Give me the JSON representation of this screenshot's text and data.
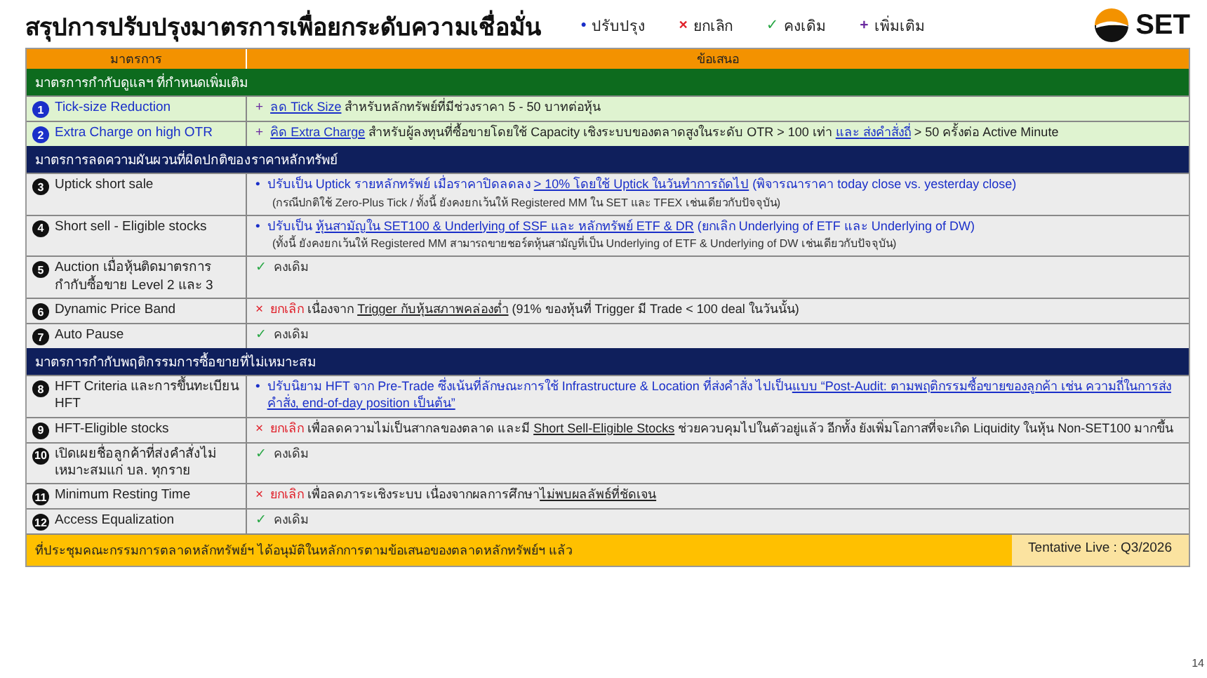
{
  "title": "สรุปการปรับปรุงมาตรการเพื่อยกระดับความเชื่อมั่น",
  "legend": [
    {
      "kind": "improve",
      "symbol": "•",
      "label": "ปรับปรุง"
    },
    {
      "kind": "cancel",
      "symbol": "×",
      "label": "ยกเลิก"
    },
    {
      "kind": "keep",
      "symbol": "✓",
      "label": "คงเดิม"
    },
    {
      "kind": "add",
      "symbol": "+",
      "label": "เพิ่มเติม"
    }
  ],
  "logo": {
    "text": "SET"
  },
  "table": {
    "columns": [
      "มาตรการ",
      "ข้อเสนอ"
    ],
    "sections": [
      {
        "kind": "added",
        "title": "มาตรการกำกับดูแลฯ ที่กำหนดเพิ่มเติม",
        "rows": [
          {
            "number": "1",
            "measure": "Tick-size Reduction",
            "proposal": {
              "kind": "add",
              "symbol": "+",
              "lines": [
                [
                  {
                    "text": "ลด Tick Size",
                    "emphasis": true
                  },
                  {
                    "text": " สำหรับหลักทรัพย์ที่มีช่วงราคา 5 - 50 บาทต่อหุ้น",
                    "emphasis": false
                  }
                ]
              ]
            }
          },
          {
            "number": "2",
            "measure": "Extra Charge on high OTR",
            "proposal": {
              "kind": "add",
              "symbol": "+",
              "lines": [
                [
                  {
                    "text": "คิด Extra Charge",
                    "emphasis": true
                  },
                  {
                    "text": " สำหรับผู้ลงทุนที่ซื้อขายโดยใช้ Capacity เชิงระบบของตลาดสูงในระดับ OTR > 100 เท่า ",
                    "emphasis": false
                  },
                  {
                    "text": "และ",
                    "emphasis": true
                  },
                  {
                    "text": " ส่งคำสั่งถี่",
                    "emphasis": true
                  },
                  {
                    "text": " > 50 ครั้งต่อ Active Minute",
                    "emphasis": false
                  }
                ]
              ]
            }
          }
        ]
      },
      {
        "kind": "standard",
        "title": "มาตรการลดความผันผวนที่ผิดปกติของราคาหลักทรัพย์",
        "rows": [
          {
            "number": "3",
            "measure": "Uptick short sale",
            "proposal": {
              "kind": "improve",
              "symbol": "•",
              "lines": [
                [
                  {
                    "text": "ปรับเป็น Uptick รายหลักทรัพย์ เมื่อราคาปิดลดลง ",
                    "emphasis": false
                  },
                  {
                    "text": "> 10% โดยใช้ Uptick ในวันทำการถัดไป",
                    "emphasis": true
                  },
                  {
                    "text": " (พิจารณาราคา today close vs. yesterday close)",
                    "emphasis": false
                  }
                ]
              ],
              "note": "(กรณีปกติใช้ Zero-Plus Tick / ทั้งนี้ ยังคงยกเว้นให้ Registered MM ใน SET และ TFEX เช่นเดียวกับปัจจุบัน)"
            }
          },
          {
            "number": "4",
            "measure": "Short sell - Eligible stocks",
            "proposal": {
              "kind": "improve",
              "symbol": "•",
              "lines": [
                [
                  {
                    "text": "ปรับเป็น ",
                    "emphasis": false
                  },
                  {
                    "text": "หุ้นสามัญใน SET100 & Underlying of SSF และ หลักทรัพย์ ETF & DR",
                    "emphasis": true
                  },
                  {
                    "text": "  (ยกเลิก Underlying of ETF และ Underlying of DW)",
                    "emphasis": false
                  }
                ]
              ],
              "note": "(ทั้งนี้ ยังคงยกเว้นให้ Registered MM สามารถขายชอร์ตหุ้นสามัญที่เป็น Underlying of ETF & Underlying of DW เช่นเดียวกับปัจจุบัน)"
            }
          },
          {
            "number": "5",
            "measure": "Auction เมื่อหุ้นติดมาตรการกำกับซื้อขาย Level 2 และ 3",
            "proposal": {
              "kind": "keep",
              "symbol": "✓",
              "label": "คงเดิม"
            }
          },
          {
            "number": "6",
            "measure": "Dynamic Price Band",
            "proposal": {
              "kind": "cancel",
              "symbol": "×",
              "label": "ยกเลิก",
              "lines": [
                [
                  {
                    "text": " เนื่องจาก ",
                    "emphasis": false
                  },
                  {
                    "text": "Trigger กับหุ้นสภาพคล่องต่ำ",
                    "emphasis": true
                  },
                  {
                    "text": " (91% ของหุ้นที่ Trigger มี Trade < 100 deal ในวันนั้น)",
                    "emphasis": false
                  }
                ]
              ]
            }
          },
          {
            "number": "7",
            "measure": "Auto Pause",
            "proposal": {
              "kind": "keep",
              "symbol": "✓",
              "label": "คงเดิม"
            }
          }
        ]
      },
      {
        "kind": "standard",
        "title": "มาตรการกำกับพฤติกรรมการซื้อขายที่ไม่เหมาะสม",
        "rows": [
          {
            "number": "8",
            "measure": "HFT Criteria และการขึ้นทะเบียน HFT",
            "proposal": {
              "kind": "improve",
              "symbol": "•",
              "lines": [
                [
                  {
                    "text": "ปรับนิยาม HFT",
                    "emphasis": false
                  },
                  {
                    "text": " จาก Pre-Trade ซึ่งเน้นที่ลักษณะการใช้ Infrastructure & Location ที่ส่งคำสั่ง ไปเป็น",
                    "emphasis": false
                  },
                  {
                    "text": "แบบ “Post-Audit: ตามพฤติกรรมซื้อขายของลูกค้า เช่น ความถี่ในการส่งคำสั่ง, end-of-day position เป็นต้น”",
                    "emphasis": true
                  }
                ]
              ]
            }
          },
          {
            "number": "9",
            "measure": "HFT-Eligible stocks",
            "proposal": {
              "kind": "cancel",
              "symbol": "×",
              "label": "ยกเลิก",
              "lines": [
                [
                  {
                    "text": " เพื่อลดความไม่เป็นสากลของตลาด และมี ",
                    "emphasis": false
                  },
                  {
                    "text": "Short Sell-Eligible Stocks",
                    "emphasis": true
                  },
                  {
                    "text": " ช่วยควบคุมไปในตัวอยู่แล้ว อีกทั้ง ยังเพิ่มโอกาสที่จะเกิด Liquidity ในหุ้น Non-SET100 มากขึ้น",
                    "emphasis": false
                  }
                ]
              ]
            }
          },
          {
            "number": "10",
            "measure": "เปิดเผยชื่อลูกค้าที่ส่งคำสั่งไม่เหมาะสมแก่ บล. ทุกราย",
            "proposal": {
              "kind": "keep",
              "symbol": "✓",
              "label": "คงเดิม"
            }
          },
          {
            "number": "11",
            "measure": "Minimum Resting Time",
            "proposal": {
              "kind": "cancel",
              "symbol": "×",
              "label": "ยกเลิก",
              "lines": [
                [
                  {
                    "text": " เพื่อลดภาระเชิงระบบ เนื่องจากผลการศึกษา",
                    "emphasis": false
                  },
                  {
                    "text": "ไม่พบผลลัพธ์ที่ชัดเจน",
                    "emphasis": true
                  }
                ]
              ]
            }
          },
          {
            "number": "12",
            "measure": "Access Equalization",
            "proposal": {
              "kind": "keep",
              "symbol": "✓",
              "label": "คงเดิม"
            }
          }
        ]
      }
    ]
  },
  "footer": {
    "text": "ที่ประชุมคณะกรรมการตลาดหลักทรัพย์ฯ ได้อนุมัติในหลักการตามข้อเสนอของตลาดหลักทรัพย์ฯ แล้ว",
    "live": "Tentative Live : Q3/2026"
  },
  "page_number": "14"
}
